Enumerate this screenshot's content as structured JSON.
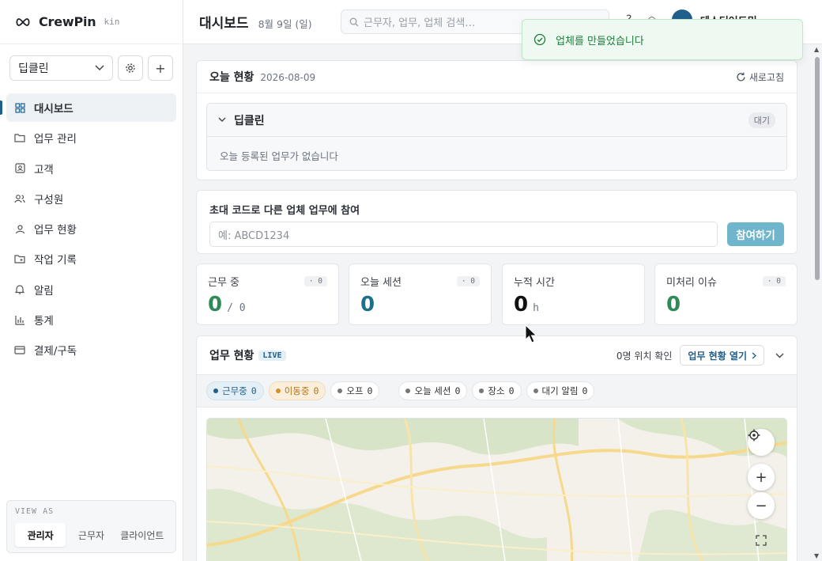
{
  "brand": {
    "name": "CrewPin",
    "tag": "kin"
  },
  "workspace": {
    "selected": "딥클린"
  },
  "nav": [
    {
      "label": "대시보드",
      "icon": "dashboard-icon",
      "active": true
    },
    {
      "label": "업무 관리",
      "icon": "folder-icon"
    },
    {
      "label": "고객",
      "icon": "contact-icon"
    },
    {
      "label": "구성원",
      "icon": "users-icon"
    },
    {
      "label": "업무 현황",
      "icon": "location-icon"
    },
    {
      "label": "작업 기록",
      "icon": "record-icon"
    },
    {
      "label": "알림",
      "icon": "bell-icon"
    },
    {
      "label": "통계",
      "icon": "chart-icon"
    },
    {
      "label": "결제/구독",
      "icon": "card-icon"
    }
  ],
  "viewas": {
    "label": "VIEW AS",
    "options": [
      "관리자",
      "근무자",
      "클라이언트"
    ],
    "selected": "관리자"
  },
  "header": {
    "title": "대시보드",
    "date": "8월 9일 (일)",
    "search_placeholder": "근무자, 업무, 업체 검색…",
    "user_name": "테스터어드민"
  },
  "toast": {
    "message": "업체를 만들었습니다"
  },
  "today": {
    "title": "오늘 현황",
    "date": "2026-08-09",
    "refresh": "새로고침",
    "company": "딥클린",
    "status": "대기",
    "empty": "오늘 등록된 업무가 없습니다"
  },
  "invite": {
    "label": "초대 코드로 다른 업체 업무에 참여",
    "placeholder": "예: ABCD1234",
    "button": "참여하기"
  },
  "stats": [
    {
      "label": "근무 중",
      "value": "0",
      "suffix": "/ 0",
      "chip": "· 0",
      "color": "#2e8b57"
    },
    {
      "label": "오늘 세션",
      "value": "0",
      "suffix": "",
      "chip": "· 0",
      "color": "#1f6f8b"
    },
    {
      "label": "누적 시간",
      "value": "0",
      "suffix": "h",
      "chip": "",
      "color": "#111111"
    },
    {
      "label": "미처리 이슈",
      "value": "0",
      "suffix": "",
      "chip": "· 0",
      "color": "#2e8b57"
    }
  ],
  "live": {
    "title": "업무 현황",
    "badge": "LIVE",
    "location_text": "0명 위치 확인",
    "open_button": "업무 현황 열기",
    "filters": [
      {
        "label": "근무중",
        "count": "0",
        "kind": "working"
      },
      {
        "label": "이동중",
        "count": "0",
        "kind": "moving"
      },
      {
        "label": "오프",
        "count": "0",
        "kind": "plain"
      },
      {
        "label": "오늘 세션",
        "count": "0",
        "kind": "plain"
      },
      {
        "label": "장소",
        "count": "0",
        "kind": "plain"
      },
      {
        "label": "대기 알림",
        "count": "0",
        "kind": "plain"
      }
    ]
  }
}
